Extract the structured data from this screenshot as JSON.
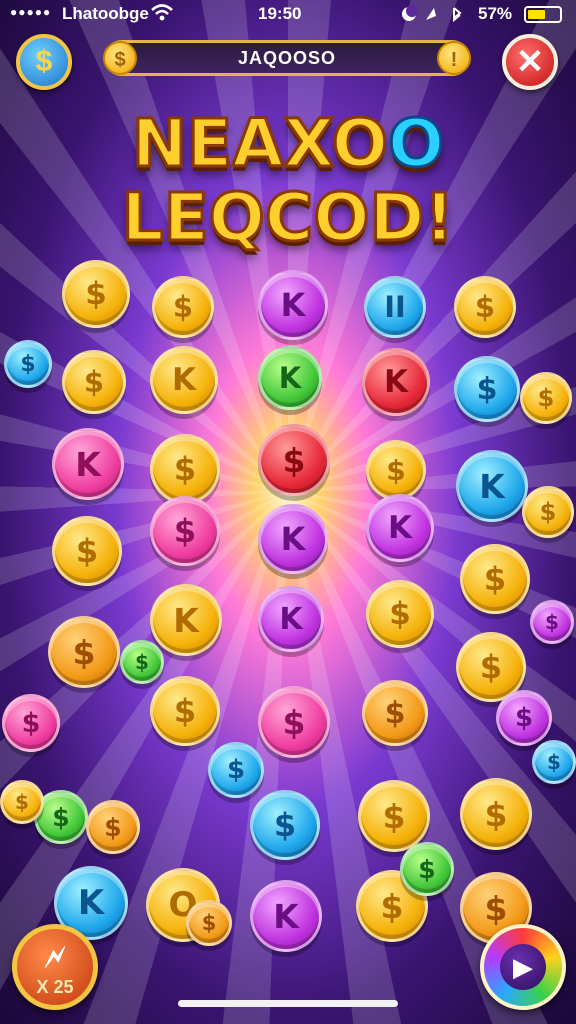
{
  "status_bar": {
    "signal": "●●●●●",
    "carrier": "Lhatoobge",
    "time": "19:50",
    "battery_percent": "57%",
    "battery_level": 0.57,
    "icons": [
      "signal-dots",
      "wifi-icon",
      "moon-icon",
      "location-icon",
      "bluetooth-icon",
      "battery-icon"
    ]
  },
  "top_bar": {
    "player_name": "JAQOOSO",
    "left_coin_symbol": "$",
    "right_coin_symbol": "!"
  },
  "coin_button": {
    "symbol": "$"
  },
  "close_button": {
    "symbol": "✕"
  },
  "title": {
    "line1_a": "NEAXO",
    "line1_b": "O",
    "line2": "LEQCOD!"
  },
  "bottom": {
    "multiplier_icon": "🗲",
    "multiplier_text": "X 25",
    "play_icon": "▶"
  },
  "colors": {
    "gold": "#f5b20a",
    "blue": "#20a8ec",
    "green": "#43c83a",
    "pink": "#f03ea0",
    "purple": "#c034e0",
    "red": "#e82a3a",
    "frame": "#f4c542"
  },
  "coins": [
    {
      "color": "gold",
      "symbol": "$"
    },
    {
      "color": "gold",
      "symbol": "$"
    },
    {
      "color": "purple",
      "symbol": "K"
    },
    {
      "color": "blue",
      "symbol": "II"
    },
    {
      "color": "gold",
      "symbol": "$"
    },
    {
      "color": "blue",
      "symbol": "$"
    },
    {
      "color": "gold",
      "symbol": "$"
    },
    {
      "color": "gold",
      "symbol": "K"
    },
    {
      "color": "green",
      "symbol": "K"
    },
    {
      "color": "red",
      "symbol": "K"
    },
    {
      "color": "blue",
      "symbol": "$"
    },
    {
      "color": "gold",
      "symbol": "$"
    },
    {
      "color": "pink",
      "symbol": "K"
    },
    {
      "color": "gold",
      "symbol": "$"
    },
    {
      "color": "red",
      "symbol": "$"
    },
    {
      "color": "gold",
      "symbol": "$"
    },
    {
      "color": "blue",
      "symbol": "K"
    },
    {
      "color": "gold",
      "symbol": "$"
    },
    {
      "color": "purple",
      "symbol": "K"
    },
    {
      "color": "purple",
      "symbol": "K"
    },
    {
      "color": "pink",
      "symbol": "$"
    },
    {
      "color": "gold",
      "symbol": "$"
    },
    {
      "color": "purple",
      "symbol": "K"
    },
    {
      "color": "gold",
      "symbol": "K"
    },
    {
      "color": "gold",
      "symbol": "$"
    },
    {
      "color": "gold",
      "symbol": "$"
    },
    {
      "color": "orange",
      "symbol": "$"
    },
    {
      "color": "green",
      "symbol": "$"
    },
    {
      "color": "gold",
      "symbol": "$"
    },
    {
      "color": "purple",
      "symbol": "$"
    },
    {
      "color": "pink",
      "symbol": "$"
    },
    {
      "color": "gold",
      "symbol": "$"
    },
    {
      "color": "pink",
      "symbol": "$"
    },
    {
      "color": "orange",
      "symbol": "$"
    },
    {
      "color": "blue",
      "symbol": "$"
    },
    {
      "color": "purple",
      "symbol": "$"
    },
    {
      "color": "blue",
      "symbol": "$"
    },
    {
      "color": "gold",
      "symbol": "$"
    },
    {
      "color": "gold",
      "symbol": "$"
    },
    {
      "color": "green",
      "symbol": "$"
    },
    {
      "color": "blue",
      "symbol": "K"
    },
    {
      "color": "gold",
      "symbol": "O"
    },
    {
      "color": "purple",
      "symbol": "K"
    },
    {
      "color": "orange",
      "symbol": "$"
    },
    {
      "color": "gold",
      "symbol": "$"
    },
    {
      "color": "orange",
      "symbol": "$"
    },
    {
      "color": "green",
      "symbol": "$"
    },
    {
      "color": "gold",
      "symbol": "$"
    },
    {
      "color": "orange",
      "symbol": "$"
    },
    {
      "color": "blue",
      "symbol": "$"
    }
  ]
}
